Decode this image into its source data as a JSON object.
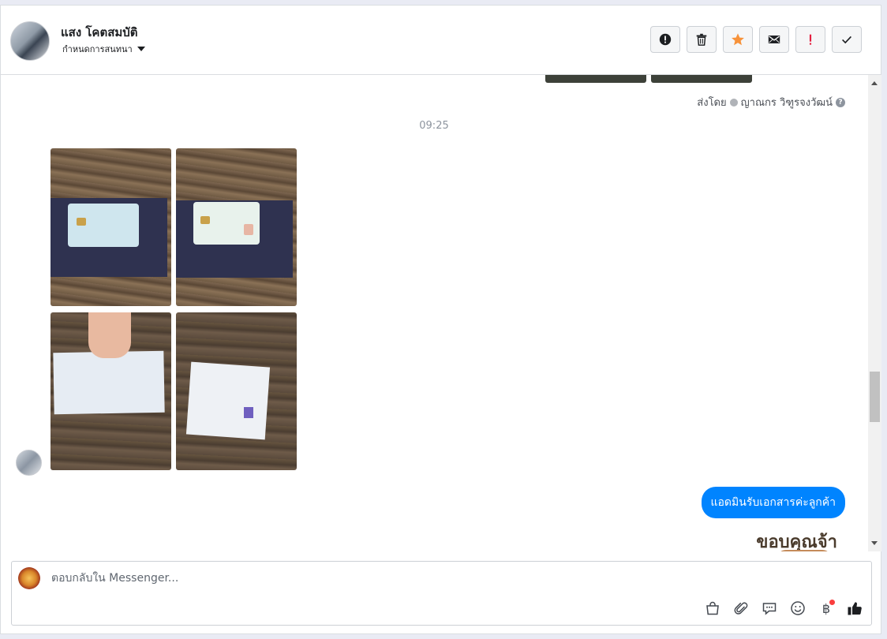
{
  "header": {
    "contact_name": "แสง โคตสมบัติ",
    "assign_label": "กำหนดการสนทนา",
    "actions": [
      {
        "name": "report-button",
        "icon": "exclamation-circle-icon"
      },
      {
        "name": "delete-button",
        "icon": "trash-icon"
      },
      {
        "name": "star-button",
        "icon": "star-icon",
        "color": "#f7923a"
      },
      {
        "name": "mark-unread-button",
        "icon": "envelope-icon"
      },
      {
        "name": "follow-up-button",
        "icon": "exclamation-icon",
        "color": "#e41e3f"
      },
      {
        "name": "mark-done-button",
        "icon": "checkmark-icon"
      }
    ]
  },
  "chat": {
    "sent_by_prefix": "ส่งโดย",
    "sent_by_name": "ญาณกร วิฑูรจงวัฒน์",
    "timestamp": "09:25",
    "photos": [
      {
        "alt": "ID card back"
      },
      {
        "alt": "ID card front"
      },
      {
        "alt": "document"
      },
      {
        "alt": "document booklet"
      }
    ],
    "outgoing_message": "แอดมินรับเอกสารค่ะลูกค้า",
    "sticker_text": "ขอบคุณจ้า"
  },
  "composer": {
    "placeholder": "ตอบกลับใน Messenger...",
    "tools": [
      "shopping-bag-icon",
      "paperclip-icon",
      "saved-reply-icon",
      "emoji-icon",
      "baht-icon",
      "thumbs-up-icon"
    ],
    "baht_symbol": "฿"
  },
  "colors": {
    "accent": "#0084ff",
    "star": "#f7923a",
    "follow_up": "#e41e3f"
  }
}
